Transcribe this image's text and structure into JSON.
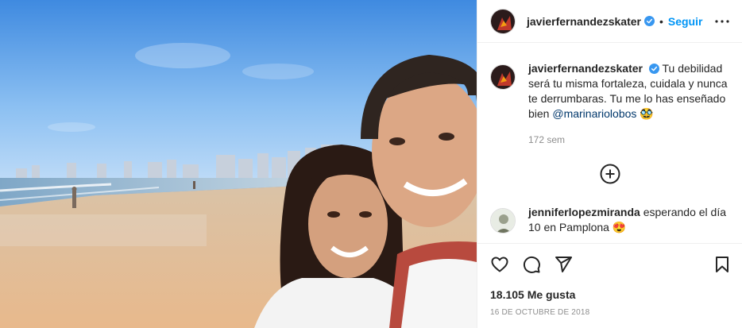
{
  "post": {
    "username": "javierfernandezskater",
    "separator": "•",
    "follow_label": "Seguir",
    "caption": "Tu debilidad será tu misma fortaleza, cuidala y nunca te derrumbaras. Tu me lo has enseñado bien",
    "caption_mention": "@marinariolobos",
    "caption_emoji": "🥸",
    "caption_time": "172 sem",
    "likes": "18.105 Me gusta",
    "date": "16 DE OCTUBRE DE 2018"
  },
  "comments": [
    {
      "username": "jenniferlopezmiranda",
      "text": "esperando el día 10 en Pamplona",
      "emoji": "😍"
    }
  ],
  "icons": {
    "verified": "verified-badge-icon",
    "more": "more-options-icon",
    "add": "load-more-comments-icon",
    "like": "heart-icon",
    "comment": "comment-icon",
    "share": "share-icon",
    "save": "bookmark-icon"
  },
  "colors": {
    "accent": "#0095f6",
    "verified": "#3897f0",
    "text": "#262626",
    "muted": "#8e8e8e",
    "mention": "#00376b"
  }
}
